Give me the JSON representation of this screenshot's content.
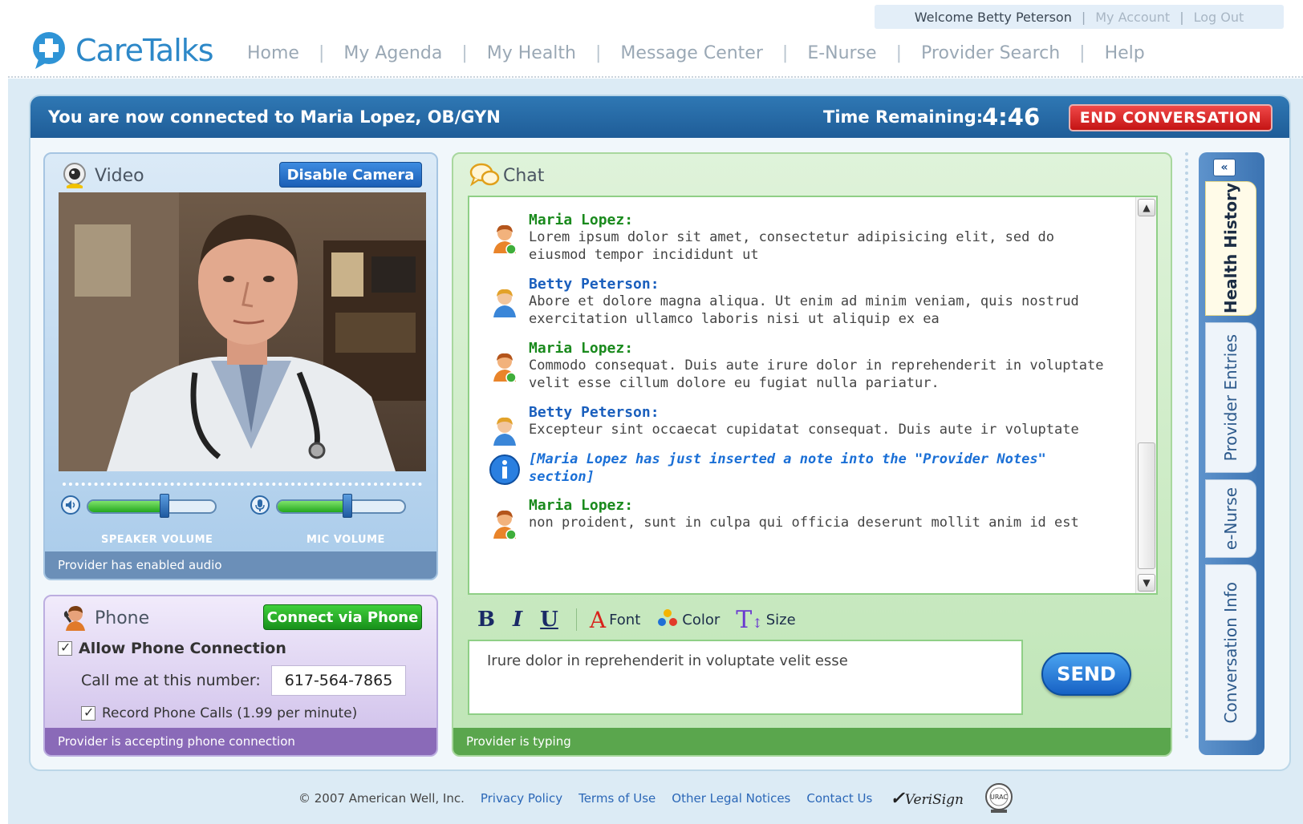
{
  "user_bar": {
    "welcome": "Welcome Betty Peterson",
    "sep": "|",
    "my_account": "My Account",
    "log_out": "Log Out"
  },
  "brand": {
    "name": "CareTalks",
    "color": "#2d88c8"
  },
  "nav": {
    "sep": "|",
    "items": [
      "Home",
      "My Agenda",
      "My Health",
      "Message Center",
      "E-Nurse",
      "Provider Search",
      "Help"
    ]
  },
  "session": {
    "connected_text": "You are now connected to Maria Lopez, OB/GYN",
    "time_label": "Time Remaining:",
    "time_value": "4:46",
    "end_button": "END CONVERSATION"
  },
  "video": {
    "title": "Video",
    "icon": "webcam-icon",
    "disable_button": "Disable Camera",
    "speaker_label": "SPEAKER VOLUME",
    "mic_label": "MIC VOLUME",
    "speaker_volume": 0.6,
    "mic_volume": 0.55,
    "status": "Provider has enabled audio"
  },
  "phone": {
    "title": "Phone",
    "icon": "phone-person-icon",
    "connect_button": "Connect via Phone",
    "allow_label": "Allow Phone Connection",
    "allow_checked": true,
    "call_label": "Call me at this number:",
    "number": "617-564-7865",
    "record_label": "Record Phone Calls (1.99 per minute)",
    "record_checked": true,
    "status": "Provider is accepting phone connection"
  },
  "chat": {
    "title": "Chat",
    "icon": "chat-bubbles-icon",
    "messages": [
      {
        "sender": "Maria Lopez:",
        "text": "Lorem ipsum dolor sit amet, consectetur adipisicing elit, sed do eiusmod tempor incididunt ut",
        "role": "provider"
      },
      {
        "sender": "Betty Peterson:",
        "text": "Abore et dolore magna aliqua. Ut enim ad minim veniam, quis nostrud exercitation ullamco laboris nisi ut aliquip ex ea",
        "role": "patient"
      },
      {
        "sender": "Maria Lopez:",
        "text": "Commodo consequat. Duis aute irure dolor in reprehenderit in voluptate velit esse cillum dolore eu fugiat nulla pariatur.",
        "role": "provider"
      },
      {
        "sender": "Betty Peterson:",
        "text": "Excepteur sint occaecat cupidatat consequat. Duis aute ir voluptate",
        "role": "patient"
      },
      {
        "note": "[Maria Lopez has just inserted a note into the \"Provider Notes\" section]"
      },
      {
        "sender": "Maria Lopez:",
        "text": "non proident, sunt in culpa qui officia deserunt mollit anim id est",
        "role": "provider"
      }
    ],
    "toolbar": {
      "bold": "B",
      "italic": "I",
      "underline": "U",
      "font": "Font",
      "color": "Color",
      "size": "Size"
    },
    "compose_text": "Irure dolor in reprehenderit in voluptate velit esse",
    "send_button": "SEND",
    "status": "Provider is typing"
  },
  "side_tabs": {
    "collapse": "«",
    "tabs": [
      "Health History",
      "Provider Entries",
      "e-Nurse",
      "Conversation Info"
    ],
    "active": "Health History"
  },
  "footer": {
    "copyright": "© 2007 American Well, Inc.",
    "links": [
      "Privacy Policy",
      "Terms of Use",
      "Other Legal Notices",
      "Contact Us"
    ],
    "verisign": "VeriSign",
    "seal_text": "URAC"
  },
  "colors": {
    "header_blue": "#1f5d98",
    "end_red": "#d41c1c",
    "provider_green": "#1a8a1d",
    "patient_blue": "#1a5fbd",
    "note_blue": "#1a6fd6"
  }
}
